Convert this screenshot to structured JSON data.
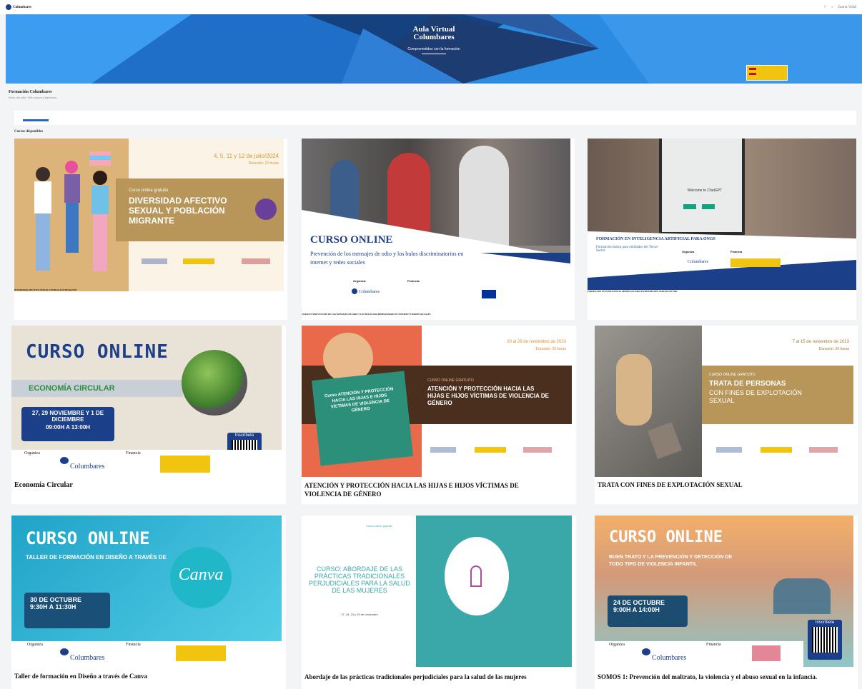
{
  "topbar": {
    "brand": "Columbares",
    "user_label": "Juana Vidal"
  },
  "hero": {
    "title_line1": "Aula Virtual",
    "title_line2": "Columbares",
    "subtitle": "Comprometidos con la formación"
  },
  "page": {
    "title": "Formación Columbares",
    "breadcrumb": "Inicio del sitio / Mis cursos y ejercicios",
    "section_label": "Cursos disponibles"
  },
  "colors": {
    "hero_blue": "#2a8be0",
    "navy": "#1c3f8a",
    "gold": "#b8965a",
    "teal": "#2b8f7a",
    "brown": "#4a2e1e"
  },
  "cards": [
    {
      "title": "DIVERSIDAD AFECTIVO SEXUAL Y POBLACIÓN MIGRANTE",
      "date": "4, 5, 11 y 12 de julio/2024",
      "duration": "Duración: 22 horas",
      "banner_kicker": "Curso online gratuito",
      "banner_title": "DIVERSIDAD AFECTIVO SEXUAL Y POBLACIÓN MIGRANTE"
    },
    {
      "title": "CURSO EN PREVENCIÓN DE LOS MENSAJES DE ODIO Y LOS BULOS DISCRIMINATORIOS EN INTERNET Y REDES SOCIALES",
      "banner_title": "CURSO ONLINE",
      "banner_text": "Prevención de los mensajes de odio y los bulos discriminatorios en internet y redes sociales",
      "organiza": "Organiza:",
      "financia": "Financia:",
      "org_name": "Columbares"
    },
    {
      "title": "FORMACIÓN EN INTELIGENCIA ARTIFICIAL PARA ENTIDADES DEL TERCER SECTOR",
      "banner_title": "FORMACIÓN EN INTELIGENCIA ARTIFICIAL PARA ONGS",
      "banner_sub": "Formación básica para entidades del Tercer Sector",
      "phone_text": "Welcome to ChatGPT",
      "organiza": "Organiza",
      "financia": "Financia",
      "org_name": "Columbares"
    },
    {
      "title": "Economía Circular",
      "banner_title": "CURSO ONLINE",
      "banner_topic": "ECONOMÍA CIRCULAR",
      "banner_dates": "27, 29 NOVIEMBRE Y 1 DE DICIEMBRE",
      "banner_time": "09:00H A 13:00H",
      "banner_cta": "Inscríbete",
      "organiza": "Organiza",
      "financia": "Financia",
      "org_name": "Columbares"
    },
    {
      "title": "ATENCIÓN Y PROTECCIÓN HACIA LAS HIJAS E HIJOS VÍCTIMAS DE VIOLENCIA DE GÉNERO",
      "date": "20 al 29 de noviembre de 2023",
      "duration": "Duración: 20 horas",
      "banner_kicker": "CURSO ONLINE GRATUITO",
      "banner_title": "ATENCIÓN Y PROTECCIÓN HACIA LAS HIJAS E HIJOS VÍCTIMAS DE VIOLENCIA DE GÉNERO",
      "book_text": "Curso ATENCIÓN Y PROTECCIÓN HACIA LAS HIJAS E HIJOS VÍCTIMAS DE VIOLENCIA DE GÉNERO"
    },
    {
      "title": "TRATA CON FINES DE EXPLOTACIÓN SEXUAL",
      "date": "7 al 15 de noviembre de 2023",
      "duration": "Duración: 20 horas",
      "banner_kicker": "CURSO ONLINE GRATUITO",
      "banner_title": "TRATA DE PERSONAS",
      "banner_title2": "CON FINES DE EXPLOTACIÓN SEXUAL"
    },
    {
      "title": "Taller de formación en Diseño a través de Canva",
      "banner_title": "CURSO ONLINE",
      "banner_topic": "TALLER DE FORMACIÓN EN DISEÑO A TRAVÉS DE",
      "banner_brand": "Canva",
      "banner_dates": "30 DE OCTUBRE",
      "banner_time": "9:30H A 11:30H",
      "organiza": "Organiza",
      "financia": "Financia",
      "org_name": "Columbares"
    },
    {
      "title": "Abordaje de las prácticas tradicionales perjudiciales para la salud de las mujeres",
      "banner_kicker": "Curso online gratuito",
      "banner_title": "CURSO: ABORDAJE DE LAS PRÁCTICAS TRADICIONALES PERJUDICIALES PARA LA SALUD DE LAS MUJERES",
      "banner_dates": "17, 18, 24 y 25 de noviembre"
    },
    {
      "title": "SOMOS 1: Prevención del maltrato, la violencia y el abuso sexual en la infancia.",
      "banner_title": "CURSO ONLINE",
      "banner_topic": "BUEN TRATO Y LA PREVENCIÓN Y DETECCIÓN DE TODO TIPO DE VIOLENCIA INFANTIL",
      "banner_dates": "24 DE OCTUBRE",
      "banner_time": "9:00H A 14:00H",
      "banner_cta": "Inscríbete",
      "organiza": "Organiza",
      "financia": "Financia",
      "org_name": "Columbares"
    }
  ]
}
